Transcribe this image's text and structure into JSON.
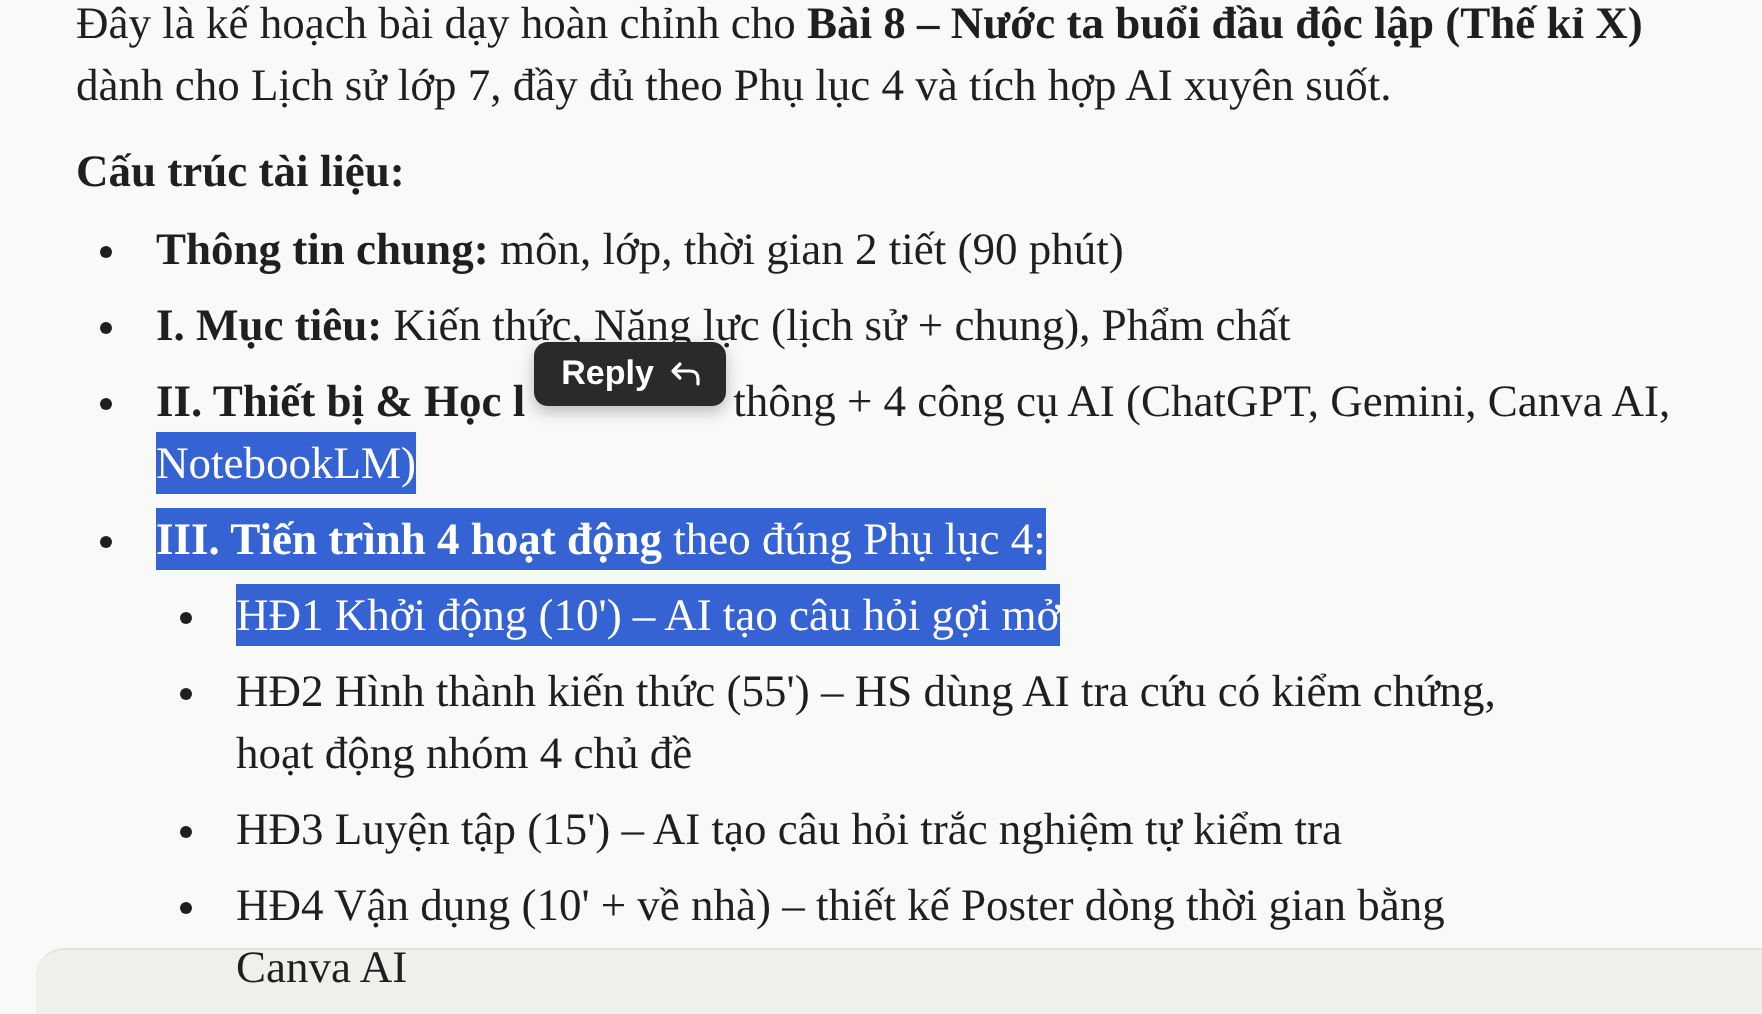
{
  "intro": {
    "lines": [
      "Đây là kế hoạch bài dạy hoàn chỉnh cho **Bài 8 – Nước ta buổi đầu độc lập (Thế kỉ X)**",
      "dành cho Lịch sử lớp 7, đầy đủ theo Phụ lục 4 và tích hợp AI xuyên suốt."
    ]
  },
  "heading": "Cấu trúc tài liệu:",
  "items": [
    {
      "lines": [
        [
          {
            "text": "Thông tin chung:",
            "bold": true,
            "highlighted": false
          },
          {
            "text": " môn, lớp, thời gian 2 tiết (90 phút)",
            "bold": false,
            "highlighted": false
          }
        ]
      ]
    },
    {
      "lines": [
        [
          {
            "text": "I. Mục tiêu:",
            "bold": true,
            "highlighted": false
          },
          {
            "text": " Kiến thức, Năng lực (lịch sử + chung), Phẩm chất",
            "bold": false,
            "highlighted": false
          }
        ]
      ]
    },
    {
      "lines": [
        [
          {
            "text": "II. Thiết bị & Học l",
            "bold": true,
            "highlighted": false
          },
          {
            "kind": "tooltip",
            "label": "Reply"
          },
          {
            "text": "thông + 4 công cụ AI (ChatGPT, Gemini, Canva AI,",
            "bold": false,
            "highlighted": false
          }
        ],
        [
          {
            "text": "NotebookLM)",
            "bold": false,
            "highlighted": true
          }
        ]
      ]
    },
    {
      "lines": [
        [
          {
            "text": "III. Tiến trình 4 hoạt động",
            "bold": true,
            "highlighted": true
          },
          {
            "text": " theo đúng Phụ lục 4:",
            "bold": false,
            "highlighted": true
          }
        ]
      ],
      "children": [
        {
          "lines": [
            [
              {
                "text": "HĐ1 Khởi động (10') – AI tạo câu hỏi gợi mở",
                "bold": false,
                "highlighted": true
              }
            ]
          ]
        },
        {
          "lines": [
            [
              {
                "text": "HĐ2 Hình thành kiến thức (55') – HS dùng AI tra cứu có kiểm chứng,",
                "bold": false,
                "highlighted": false
              }
            ],
            [
              {
                "text": "hoạt động nhóm 4 chủ đề",
                "bold": false,
                "highlighted": false
              }
            ]
          ]
        },
        {
          "lines": [
            [
              {
                "text": "HĐ3 Luyện tập (15') – AI tạo câu hỏi trắc nghiệm tự kiểm tra",
                "bold": false,
                "highlighted": false
              }
            ]
          ]
        },
        {
          "lines": [
            [
              {
                "text": "HĐ4 Vận dụng (10' + về nhà) – thiết kế Poster dòng thời gian bằng",
                "bold": false,
                "highlighted": false
              }
            ],
            [
              {
                "text": "Canva AI",
                "bold": false,
                "highlighted": false
              }
            ]
          ]
        }
      ]
    }
  ]
}
